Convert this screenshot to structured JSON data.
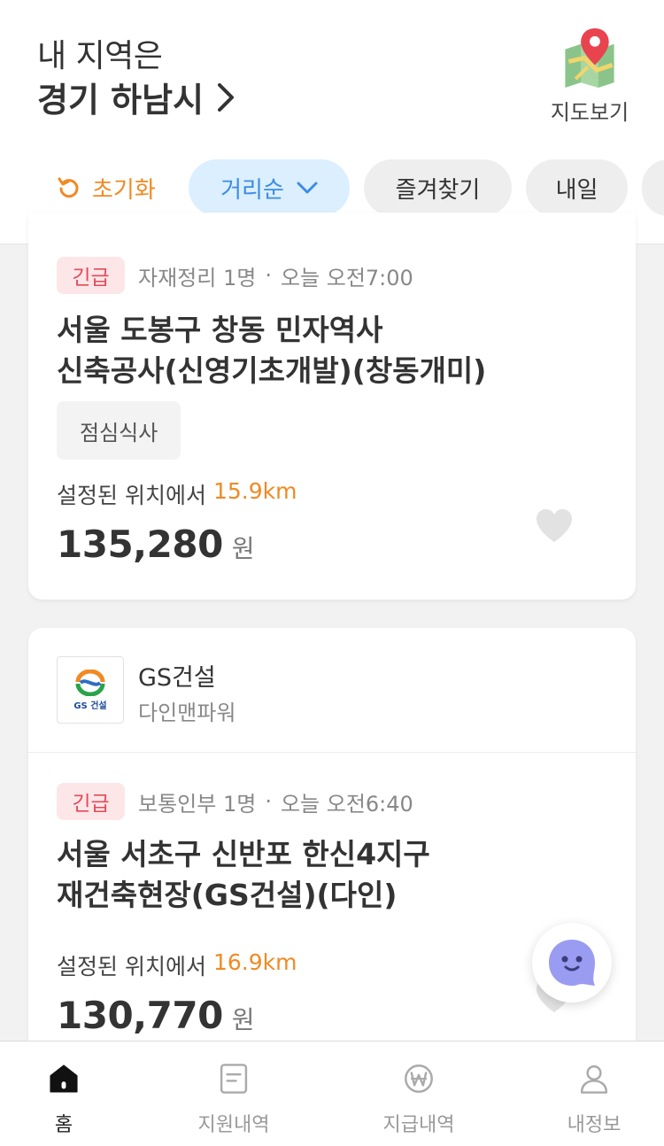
{
  "header": {
    "region_label": "내 지역은",
    "region_name": "경기 하남시",
    "map_label": "지도보기"
  },
  "filters": {
    "reset_label": "초기화",
    "sort_label": "거리순",
    "favorites_label": "즐겨찾기",
    "tomorrow_label": "내일"
  },
  "jobs": [
    {
      "badge": "긴급",
      "category": "자재정리 1명",
      "time": "오늘 오전7:00",
      "title_line1": "서울 도봉구 창동 민자역사",
      "title_line2": "신축공사(신영기초개발)(창동개미)",
      "tag": "점심식사",
      "distance_prefix": "설정된 위치에서",
      "distance": "15.9km",
      "pay": "135,280",
      "pay_unit": "원"
    },
    {
      "company_name": "GS건설",
      "company_sub": "다인맨파워",
      "company_logo_text": "GS 건설",
      "badge": "긴급",
      "category": "보통인부 1명",
      "time": "오늘 오전6:40",
      "title_line1": "서울 서초구 신반포 한신4지구",
      "title_line2": "재건축현장(GS건설)(다인)",
      "distance_prefix": "설정된 위치에서",
      "distance": "16.9km",
      "pay": "130,770",
      "pay_unit": "원"
    }
  ],
  "bottom_nav": {
    "home": "홈",
    "apply_history": "지원내역",
    "payment_history": "지급내역",
    "my_info": "내정보"
  },
  "colors": {
    "accent_orange": "#f08a24",
    "sort_chip_bg": "#dcefff",
    "sort_chip_text": "#3b8de6",
    "urgent_bg": "#fde6e8",
    "urgent_text": "#e44b5a"
  }
}
